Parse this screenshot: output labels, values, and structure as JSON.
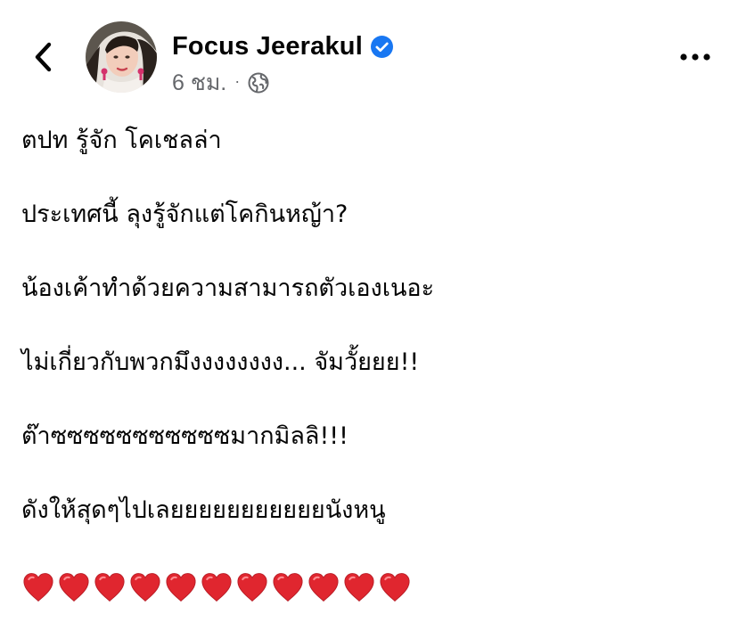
{
  "post": {
    "author": "Focus Jeerakul",
    "verified": true,
    "timestamp": "6 ชม.",
    "separator": "·",
    "audience_icon": "globe-icon",
    "lines": [
      "ตปท รู้จัก  โคเชลล่า",
      "ประเทศนี้ ลุงรู้จักแต่โคกินหญ้า?",
      "น้องเค้าทำด้วยความสามารถตัวเองเนอะ",
      "ไม่เกี่ยวกับพวกมึงงงงงงงง... จัมวั้ยยย!!",
      "ต๊าซซซซซซซซซซซมากมิลลิ!!!",
      "ดังให้สุดๆไปเลยยยยยยยยยยยนังหนู"
    ],
    "heart_count": 11
  },
  "icons": {
    "back": "chevron-left-icon",
    "more": "more-horizontal-icon",
    "verified": "verified-badge-icon",
    "heart": "red-heart-emoji"
  },
  "colors": {
    "verified_blue": "#1877f2",
    "meta_gray": "#65676b",
    "heart_red": "#e0262f"
  }
}
